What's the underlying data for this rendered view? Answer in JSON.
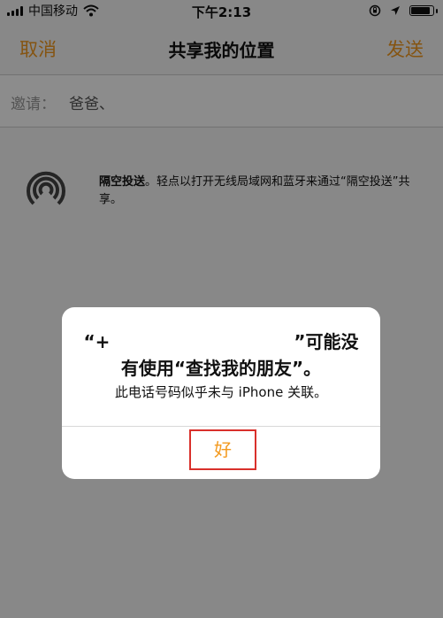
{
  "status_bar": {
    "carrier": "中国移动",
    "time": "下午2:13",
    "battery_level": 0.9,
    "icons": [
      "signal-icon",
      "wifi-icon",
      "orientation-lock-icon",
      "location-arrow-icon",
      "battery-icon"
    ]
  },
  "nav": {
    "cancel_label": "取消",
    "title": "共享我的位置",
    "send_label": "发送"
  },
  "invite": {
    "label": "邀请：",
    "value": "爸爸、"
  },
  "airdrop": {
    "icon": "airdrop-icon",
    "title": "隔空投送",
    "description": "。轻点以打开无线局域网和蓝牙来通过“隔空投送”共享。"
  },
  "alert": {
    "title_prefix": "“+",
    "title_suffix": "”可能没",
    "title_line2": "有使用“查找我的朋友”。",
    "message": "此电话号码似乎未与 iPhone 关联。",
    "ok_label": "好"
  },
  "colors": {
    "accent": "#f39a1f",
    "highlight_border": "#d9302b",
    "overlay": "rgba(0,0,0,0.45)"
  }
}
